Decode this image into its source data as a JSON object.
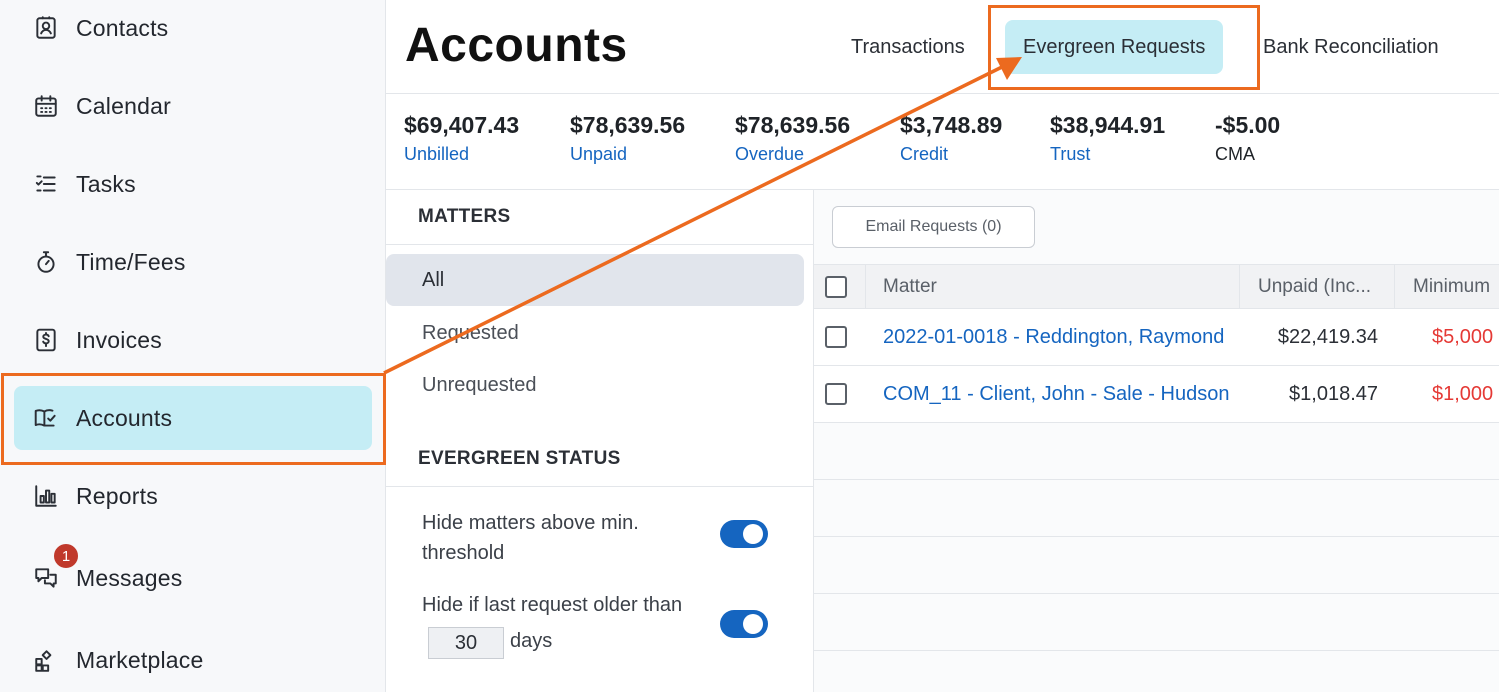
{
  "sidebar": {
    "items": [
      {
        "label": "Contacts",
        "icon": "contacts-icon"
      },
      {
        "label": "Calendar",
        "icon": "calendar-icon"
      },
      {
        "label": "Tasks",
        "icon": "tasks-icon"
      },
      {
        "label": "Time/Fees",
        "icon": "stopwatch-icon"
      },
      {
        "label": "Invoices",
        "icon": "invoice-icon"
      },
      {
        "label": "Accounts",
        "icon": "book-check-icon",
        "active": true
      },
      {
        "label": "Reports",
        "icon": "bar-chart-icon"
      },
      {
        "label": "Messages",
        "icon": "chat-icon",
        "badge": "1"
      },
      {
        "label": "Marketplace",
        "icon": "grid-plus-icon"
      }
    ]
  },
  "header": {
    "title": "Accounts",
    "tabs": [
      {
        "label": "Transactions"
      },
      {
        "label": "Evergreen Requests",
        "active": true
      },
      {
        "label": "Bank Reconciliation"
      }
    ]
  },
  "summary": [
    {
      "amount": "$69,407.43",
      "label": "Unbilled"
    },
    {
      "amount": "$78,639.56",
      "label": "Unpaid"
    },
    {
      "amount": "$78,639.56",
      "label": "Overdue"
    },
    {
      "amount": "$3,748.89",
      "label": "Credit"
    },
    {
      "amount": "$38,944.91",
      "label": "Trust"
    },
    {
      "amount": "-$5.00",
      "label": "CMA"
    }
  ],
  "filters": {
    "matters_title": "MATTERS",
    "matters": [
      {
        "label": "All",
        "active": true
      },
      {
        "label": "Requested"
      },
      {
        "label": "Unrequested"
      }
    ],
    "status_title": "EVERGREEN STATUS",
    "toggles": [
      {
        "line1": "Hide matters above min.",
        "line2": "threshold",
        "on": true
      },
      {
        "line1": "Hide if last request older than",
        "days_value": "30",
        "days_label": "days",
        "on": true
      }
    ]
  },
  "content": {
    "email_button": "Email Requests (0)",
    "columns": [
      "Matter",
      "Unpaid (Inc...",
      "Minimum"
    ],
    "rows": [
      {
        "matter": "2022-01-0018 - Reddington, Raymond",
        "unpaid": "$22,419.34",
        "minimum": "$5,000"
      },
      {
        "matter": "COM_11 - Client, John - Sale - Hudson",
        "unpaid": "$1,018.47",
        "minimum": "$1,000"
      }
    ]
  },
  "colors": {
    "accent_active": "#c5edf5",
    "link": "#1565c0",
    "annotation": "#ec6a1f",
    "negative": "#e53935"
  }
}
